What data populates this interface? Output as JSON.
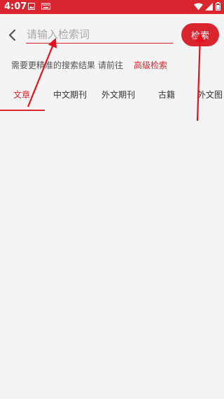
{
  "status_bar": {
    "time": "4:07"
  },
  "search": {
    "placeholder": "请输入检索词",
    "button_label": "检索"
  },
  "hint": {
    "text": "需要更精准的搜索结果 请前往",
    "link_label": "高级检索"
  },
  "tabs": [
    {
      "label": "文章",
      "active": true
    },
    {
      "label": "中文期刊"
    },
    {
      "label": "外文期刊"
    },
    {
      "label": "古籍"
    },
    {
      "label": "外文图"
    }
  ],
  "colors": {
    "accent": "#d9262e",
    "background": "#f4f4f4",
    "annotation": "#e8101c"
  }
}
